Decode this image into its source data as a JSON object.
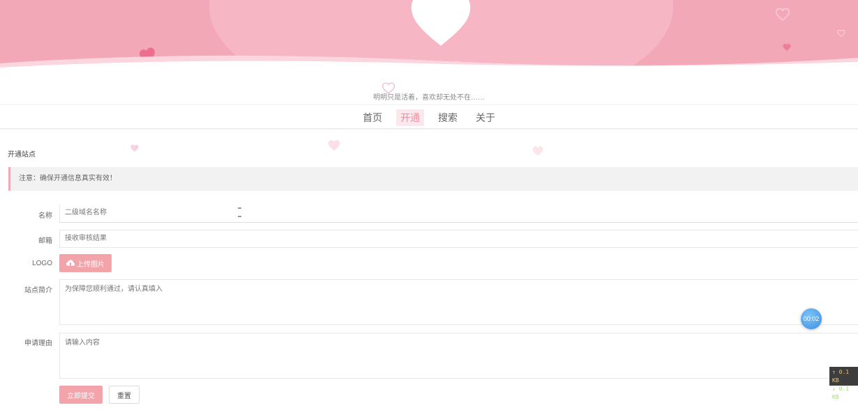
{
  "header": {
    "slogan": "明明只是活着，喜欢却无处不在……"
  },
  "nav": {
    "items": [
      {
        "label": "首页",
        "active": false
      },
      {
        "label": "开通",
        "active": true
      },
      {
        "label": "搜索",
        "active": false
      },
      {
        "label": "关于",
        "active": false
      }
    ]
  },
  "page": {
    "section_title": "开通站点",
    "notice": "注意：确保开通信息真实有效！"
  },
  "form": {
    "name_label": "名称",
    "name_placeholder": "二级域名名称",
    "email_label": "邮箱",
    "email_placeholder": "接收审核结果",
    "logo_label": "LOGO",
    "upload_label": "上传图片",
    "upload_icon": "cloud-upload-icon",
    "intro_label": "站点简介",
    "intro_placeholder": "为保障您顺利通过，请认真填入",
    "reason_label": "申请理由",
    "reason_placeholder": "请输入内容",
    "submit_label": "立即提交",
    "reset_label": "重置"
  },
  "widgets": {
    "timer": "00:02",
    "upload_speed": "↑ 0.1 KB",
    "download_speed": "↓ 0.1 KB"
  },
  "colors": {
    "banner": "#f3a8b8",
    "accent": "#f3a3aa",
    "nav_active_bg": "#fbe8ec",
    "timer_badge": "#4a9ff0"
  }
}
